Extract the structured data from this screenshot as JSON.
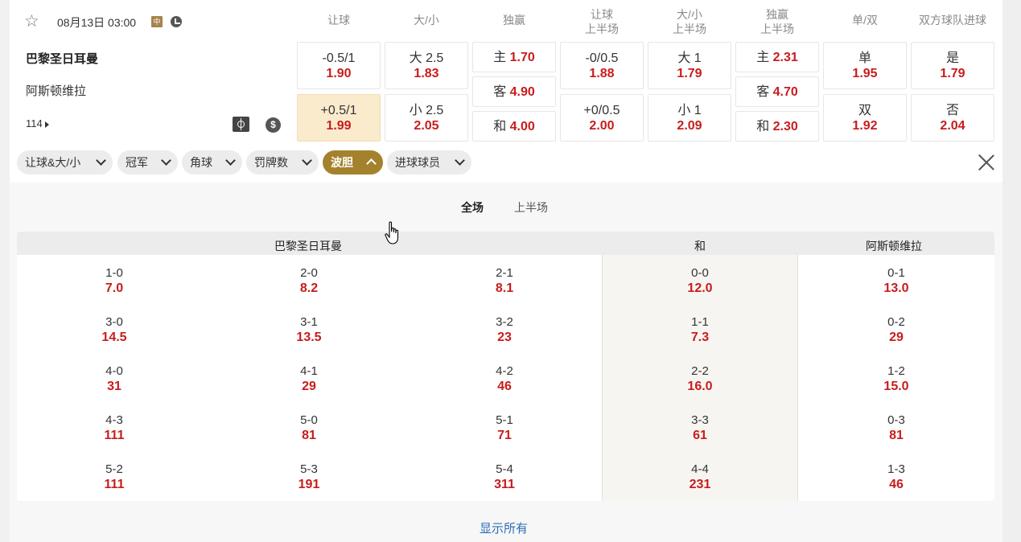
{
  "match": {
    "datetime": "08月13日 03:00",
    "lang_badge": "中",
    "team_home": "巴黎圣日耳曼",
    "team_away": "阿斯顿维拉",
    "more_markets": "114",
    "icons": [
      "star-icon",
      "clock-icon",
      "field-icon",
      "dollar-icon"
    ]
  },
  "columns": [
    {
      "l1": "让球",
      "l2": ""
    },
    {
      "l1": "大/小",
      "l2": ""
    },
    {
      "l1": "独赢",
      "l2": ""
    },
    {
      "l1": "让球",
      "l2": "上半场"
    },
    {
      "l1": "大/小",
      "l2": "上半场"
    },
    {
      "l1": "独赢",
      "l2": "上半场"
    },
    {
      "l1": "单/双",
      "l2": ""
    },
    {
      "l1": "双方球队进球",
      "l2": ""
    }
  ],
  "odds": {
    "handicap": [
      {
        "label": "-0.5/1",
        "odd": "1.90"
      },
      {
        "label": "+0.5/1",
        "odd": "1.99"
      }
    ],
    "total": [
      {
        "label": "大 2.5",
        "odd": "1.83"
      },
      {
        "label": "小 2.5",
        "odd": "2.05"
      }
    ],
    "moneyline": [
      {
        "label": "主",
        "odd": "1.70"
      },
      {
        "label": "客",
        "odd": "4.90"
      },
      {
        "label": "和",
        "odd": "4.00"
      }
    ],
    "handicap_1h": [
      {
        "label": "-0/0.5",
        "odd": "1.88"
      },
      {
        "label": "+0/0.5",
        "odd": "2.00"
      }
    ],
    "total_1h": [
      {
        "label": "大 1",
        "odd": "1.79"
      },
      {
        "label": "小 1",
        "odd": "2.09"
      }
    ],
    "moneyline_1h": [
      {
        "label": "主",
        "odd": "2.31"
      },
      {
        "label": "客",
        "odd": "4.70"
      },
      {
        "label": "和",
        "odd": "2.30"
      }
    ],
    "odd_even": [
      {
        "label": "单",
        "odd": "1.95"
      },
      {
        "label": "双",
        "odd": "1.92"
      }
    ],
    "btts": [
      {
        "label": "是",
        "odd": "1.79"
      },
      {
        "label": "否",
        "odd": "2.04"
      }
    ]
  },
  "tabs": [
    "让球&大/小",
    "冠军",
    "角球",
    "罚牌数",
    "波胆",
    "进球球员"
  ],
  "active_tab": "波胆",
  "subtabs": [
    "全场",
    "上半场"
  ],
  "correct_score": {
    "headers": {
      "home": "巴黎圣日耳曼",
      "draw": "和",
      "away": "阿斯顿维拉"
    },
    "home": [
      [
        {
          "s": "1-0",
          "o": "7.0"
        },
        {
          "s": "2-0",
          "o": "8.2"
        },
        {
          "s": "2-1",
          "o": "8.1"
        }
      ],
      [
        {
          "s": "3-0",
          "o": "14.5"
        },
        {
          "s": "3-1",
          "o": "13.5"
        },
        {
          "s": "3-2",
          "o": "23"
        }
      ],
      [
        {
          "s": "4-0",
          "o": "31"
        },
        {
          "s": "4-1",
          "o": "29"
        },
        {
          "s": "4-2",
          "o": "46"
        }
      ],
      [
        {
          "s": "4-3",
          "o": "111"
        },
        {
          "s": "5-0",
          "o": "81"
        },
        {
          "s": "5-1",
          "o": "71"
        }
      ],
      [
        {
          "s": "5-2",
          "o": "111"
        },
        {
          "s": "5-3",
          "o": "191"
        },
        {
          "s": "5-4",
          "o": "311"
        }
      ]
    ],
    "draw": [
      {
        "s": "0-0",
        "o": "12.0"
      },
      {
        "s": "1-1",
        "o": "7.3"
      },
      {
        "s": "2-2",
        "o": "16.0"
      },
      {
        "s": "3-3",
        "o": "61"
      },
      {
        "s": "4-4",
        "o": "231"
      }
    ],
    "away": [
      {
        "s": "0-1",
        "o": "13.0"
      },
      {
        "s": "0-2",
        "o": "29"
      },
      {
        "s": "1-2",
        "o": "15.0"
      },
      {
        "s": "0-3",
        "o": "81"
      },
      {
        "s": "1-3",
        "o": "46"
      }
    ]
  },
  "show_all": "显示所有",
  "colors": {
    "odd_red": "#c81c1c",
    "active_tab": "#a4822d",
    "highlight": "#fbebcd",
    "link": "#2a6db5"
  }
}
